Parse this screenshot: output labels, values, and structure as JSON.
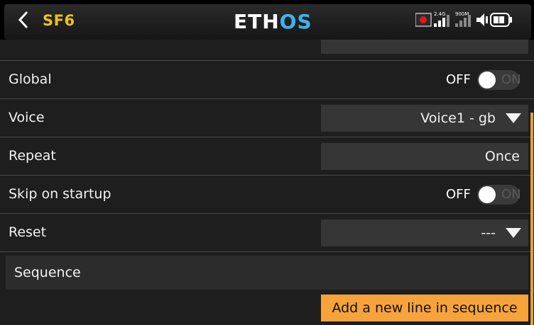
{
  "header": {
    "model_name": "SF6",
    "logo_part1": "ETH",
    "logo_part2": "OS",
    "radio_24": "2.4G",
    "radio_900": "900M"
  },
  "rows": [
    {
      "label": "Global",
      "type": "toggle",
      "off": "OFF",
      "on": "ON",
      "state": "off"
    },
    {
      "label": "Voice",
      "type": "dropdown",
      "value": "Voice1 - gb"
    },
    {
      "label": "Repeat",
      "type": "field",
      "value": "Once"
    },
    {
      "label": "Skip on startup",
      "type": "toggle",
      "off": "OFF",
      "on": "ON",
      "state": "off"
    },
    {
      "label": "Reset",
      "type": "dropdown",
      "value": "---"
    }
  ],
  "sequence": {
    "label": "Sequence"
  },
  "add_button": {
    "label": "Add a new line in sequence"
  },
  "colors": {
    "accent": "#f6a33b",
    "model_name": "#e9c320",
    "logo_os": "#3fb3e8"
  }
}
